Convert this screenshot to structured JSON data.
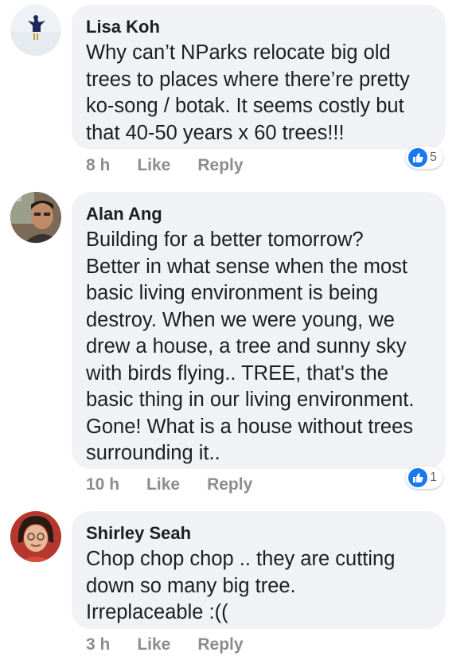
{
  "comments": [
    {
      "author": "Lisa Koh",
      "text": "Why can’t NParks relocate big old\ntrees to places where there’re pretty\nko-song / botak. It seems costly but\nthat 40-50 years x 60 trees!!!",
      "time": "8 h",
      "like": "Like",
      "reply": "Reply",
      "reaction_count": "5",
      "avatar_icon": "user-avatar-snow-figure"
    },
    {
      "author": "Alan Ang",
      "text": "Building for a better tomorrow?\nBetter in what sense when the most\nbasic living environment is being\ndestroy. When we were young, we\ndrew a house, a tree and sunny sky\nwith birds flying.. TREE, that's the\nbasic thing  in our living environment.\nGone! What is a house without trees\nsurrounding it..",
      "time": "10 h",
      "like": "Like",
      "reply": "Reply",
      "reaction_count": "1",
      "avatar_icon": "user-avatar-man-photo"
    },
    {
      "author": "Shirley Seah",
      "text": "Chop chop chop .. they are cutting\ndown so many big tree.\nIrreplaceable :((",
      "time": "3 h",
      "like": "Like",
      "reply": "Reply",
      "avatar_icon": "user-avatar-woman-photo"
    }
  ],
  "colors": {
    "bubble": "#f0f2f5",
    "text": "#1c1e21",
    "meta": "#8a8d91",
    "like_blue": "#1877f2"
  }
}
